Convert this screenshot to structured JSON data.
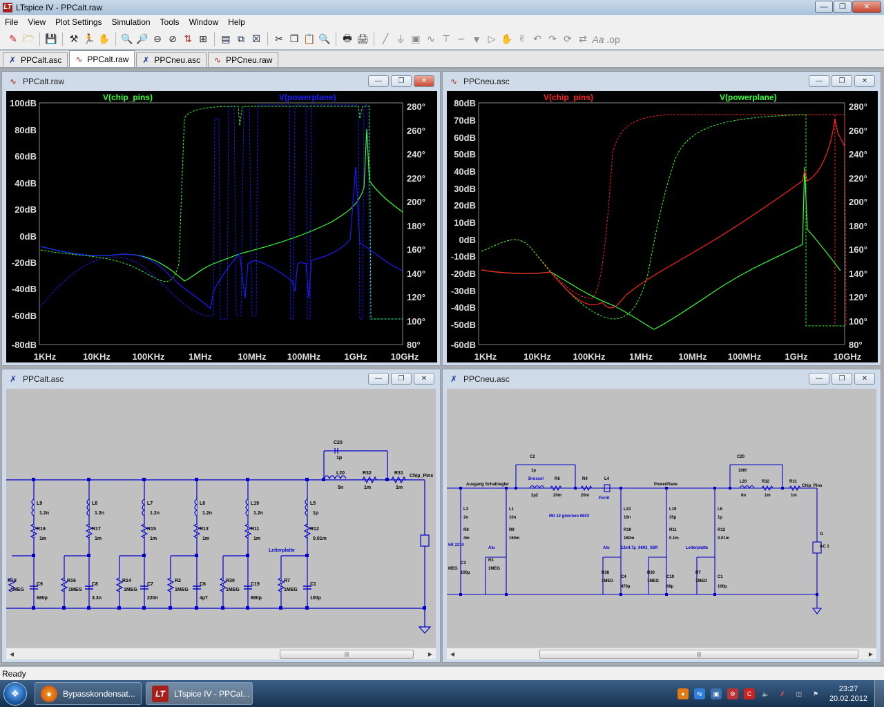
{
  "app": {
    "title": "LTspice IV - PPCalt.raw",
    "logo": "LT"
  },
  "menu": [
    "File",
    "View",
    "Plot Settings",
    "Simulation",
    "Tools",
    "Window",
    "Help"
  ],
  "tabs": [
    {
      "label": "PPCalt.asc",
      "icon": "schematic-icon"
    },
    {
      "label": "PPCalt.raw",
      "icon": "waveform-icon",
      "active": true
    },
    {
      "label": "PPCneu.asc",
      "icon": "schematic-icon"
    },
    {
      "label": "PPCneu.raw",
      "icon": "waveform-icon"
    }
  ],
  "plot_left": {
    "title": "PPCalt.raw",
    "trace1_name": "V(chip_pins)",
    "trace2_name": "V(powerplane)",
    "trace1_color": "#33ff33",
    "trace2_color": "#1a1aff",
    "y_ticks": [
      "100dB",
      "80dB",
      "60dB",
      "40dB",
      "20dB",
      "0dB",
      "-20dB",
      "-40dB",
      "-60dB",
      "-80dB"
    ],
    "y2_ticks": [
      "280°",
      "260°",
      "240°",
      "220°",
      "200°",
      "180°",
      "160°",
      "140°",
      "120°",
      "100°",
      "80°"
    ],
    "x_ticks": [
      "1KHz",
      "10KHz",
      "100KHz",
      "1MHz",
      "10MHz",
      "100MHz",
      "1GHz",
      "10GHz"
    ]
  },
  "plot_right": {
    "title": "PPCneu.asc",
    "trace1_name": "V(chip_pins)",
    "trace2_name": "V(powerplane)",
    "trace1_color": "#ff2020",
    "trace2_color": "#33ff33",
    "y_ticks": [
      "80dB",
      "70dB",
      "60dB",
      "50dB",
      "40dB",
      "30dB",
      "20dB",
      "10dB",
      "0dB",
      "-10dB",
      "-20dB",
      "-30dB",
      "-40dB",
      "-50dB",
      "-60dB"
    ],
    "y2_ticks": [
      "280°",
      "260°",
      "240°",
      "220°",
      "200°",
      "180°",
      "160°",
      "140°",
      "120°",
      "100°",
      "80°"
    ],
    "x_ticks": [
      "1KHz",
      "10KHz",
      "100KHz",
      "1MHz",
      "10MHz",
      "100MHz",
      "1GHz",
      "10GHz"
    ]
  },
  "schem_left": {
    "title": "PPCalt.asc",
    "c20": "C20",
    "c20v": "1p",
    "l20": "L20",
    "l20v": "5n",
    "r32": "R32",
    "r32v": "1m",
    "r31": "R31",
    "r31v": "1m",
    "chip": "Chip_Pins",
    "branches": [
      {
        "l": "L9",
        "lv": "1.2n",
        "r": "R19",
        "rv": "1m",
        "rs": "R18",
        "rsv": "1MEG",
        "c": "C9",
        "cv": "680p"
      },
      {
        "l": "L8",
        "lv": "1.2n",
        "r": "R17",
        "rv": "1m",
        "rs": "R16",
        "rsv": "1MEG",
        "c": "C8",
        "cv": "3.3n"
      },
      {
        "l": "L7",
        "lv": "1.2n",
        "r": "R15",
        "rv": "1m",
        "rs": "R14",
        "rsv": "1MEG",
        "c": "C7",
        "cv": "220n"
      },
      {
        "l": "L6",
        "lv": "1.2n",
        "r": "R13",
        "rv": "1m",
        "rs": "R2",
        "rsv": "1MEG",
        "c": "C6",
        "cv": "4µ7"
      },
      {
        "l": "L19",
        "lv": "1.2n",
        "r": "R11",
        "rv": "1m",
        "rs": "R30",
        "rsv": "1MEG",
        "c": "C19",
        "cv": "680p"
      },
      {
        "l": "L5",
        "lv": "1p",
        "r": "R12",
        "rv": "0.01m",
        "rs": "R7",
        "rsv": "1MEG",
        "c": "C1",
        "cv": "100p"
      }
    ],
    "leiterplatte": "Leiterplatte"
  },
  "schem_right": {
    "title": "PPCneu.asc",
    "ausgang": "Ausgang Schaltregler",
    "drossel": "Drossel",
    "c2": "C2",
    "c2v": "1p",
    "l2v": "2µ2",
    "r6": "R6",
    "r6v": "20m",
    "r4": "R4",
    "r4v": "20m",
    "l4": "L4",
    "ferrit": "Ferrit",
    "powerplane": "PowerPlane",
    "c20": "C20",
    "c20v": "100f",
    "l20": "L20",
    "l20v": "6n",
    "r32": "R32",
    "r32v": "1m",
    "r31": "R31",
    "r31v": "1m",
    "chip": "Chip_Pins",
    "i1": "I1",
    "ac": "AC 1",
    "mit12": "Mit 12 gleichen 0603",
    "alu1": "Alu",
    "alu2": "Alu",
    "x6r": "12x4.7µ_0603_X6R",
    "leiterplatte": "Leiterplatte",
    "l3": "L3",
    "l3v": "2n",
    "r8": "R8",
    "r8v": "4m",
    "r5": "5R 2210",
    "c3": "C3",
    "c3v": "100µ",
    "r3": "R3",
    "r3v": "1MEG",
    "meg": "MEG",
    "l1": "L1",
    "l1v": "10n",
    "r9": "R9",
    "r9v": "160m",
    "l23": "L23",
    "l23v": "10n",
    "r10": "R10",
    "r10v": "160m",
    "r38": "R38",
    "r38v": "1MEG",
    "c4": "C4",
    "c4v": "470µ",
    "l19": "L19",
    "l19v": "35p",
    "r11": "R11",
    "r11v": "0.1m",
    "r30": "R30",
    "r30v": "1MEG",
    "c19": "C19",
    "c19v": "68µ",
    "l6": "L6",
    "l6v": "1p",
    "r12": "R12",
    "r12v": "0.01m",
    "r7": "R7",
    "r7v": "1MEG",
    "c1": "C1",
    "c1v": "100p"
  },
  "status": "Ready",
  "taskbar": [
    {
      "label": "Bypasskondensat...",
      "icon": "firefox-icon"
    },
    {
      "label": "LTspice IV - PPCal...",
      "icon": "ltspice-icon",
      "active": true
    }
  ],
  "clock": {
    "time": "23:27",
    "date": "20.02.2012"
  }
}
